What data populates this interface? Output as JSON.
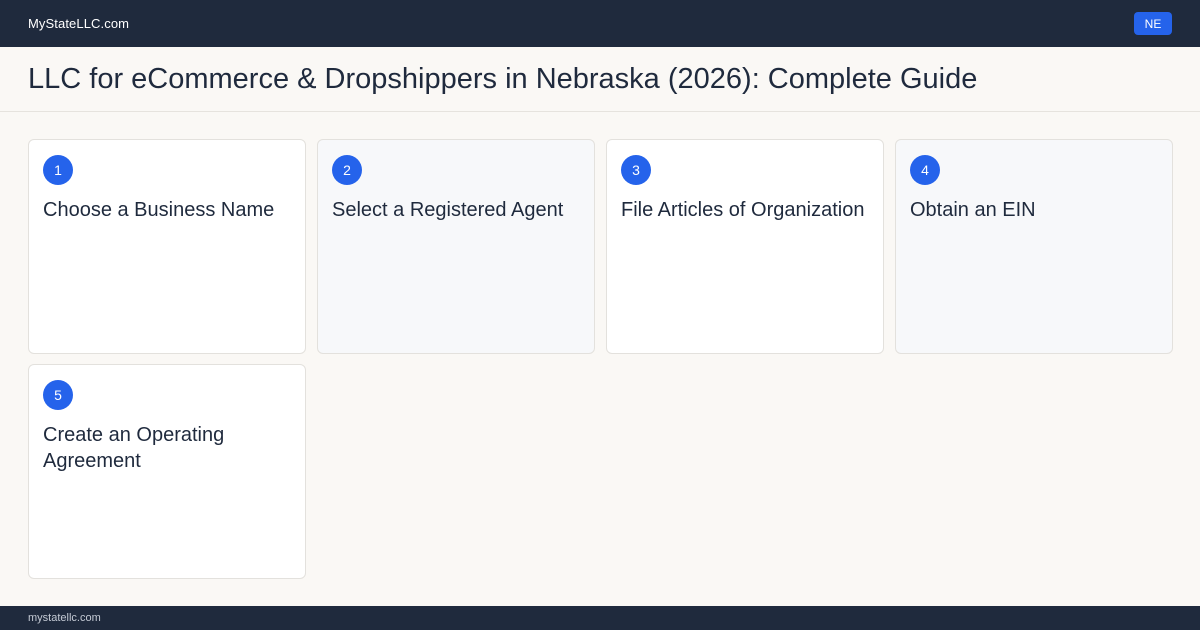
{
  "header": {
    "brand": "MyStateLLC.com",
    "state_code": "NE"
  },
  "page": {
    "title": "LLC for eCommerce & Dropshippers in Nebraska (2026): Complete Guide"
  },
  "steps": [
    {
      "number": "1",
      "title": "Choose a Business Name"
    },
    {
      "number": "2",
      "title": "Select a Registered Agent"
    },
    {
      "number": "3",
      "title": "File Articles of Organization"
    },
    {
      "number": "4",
      "title": "Obtain an EIN"
    },
    {
      "number": "5",
      "title": "Create an Operating Agreement"
    }
  ],
  "footer": {
    "domain": "mystatellc.com"
  },
  "colors": {
    "nav_background": "#1f2a3d",
    "accent": "#2563eb",
    "page_background": "#faf8f5"
  }
}
